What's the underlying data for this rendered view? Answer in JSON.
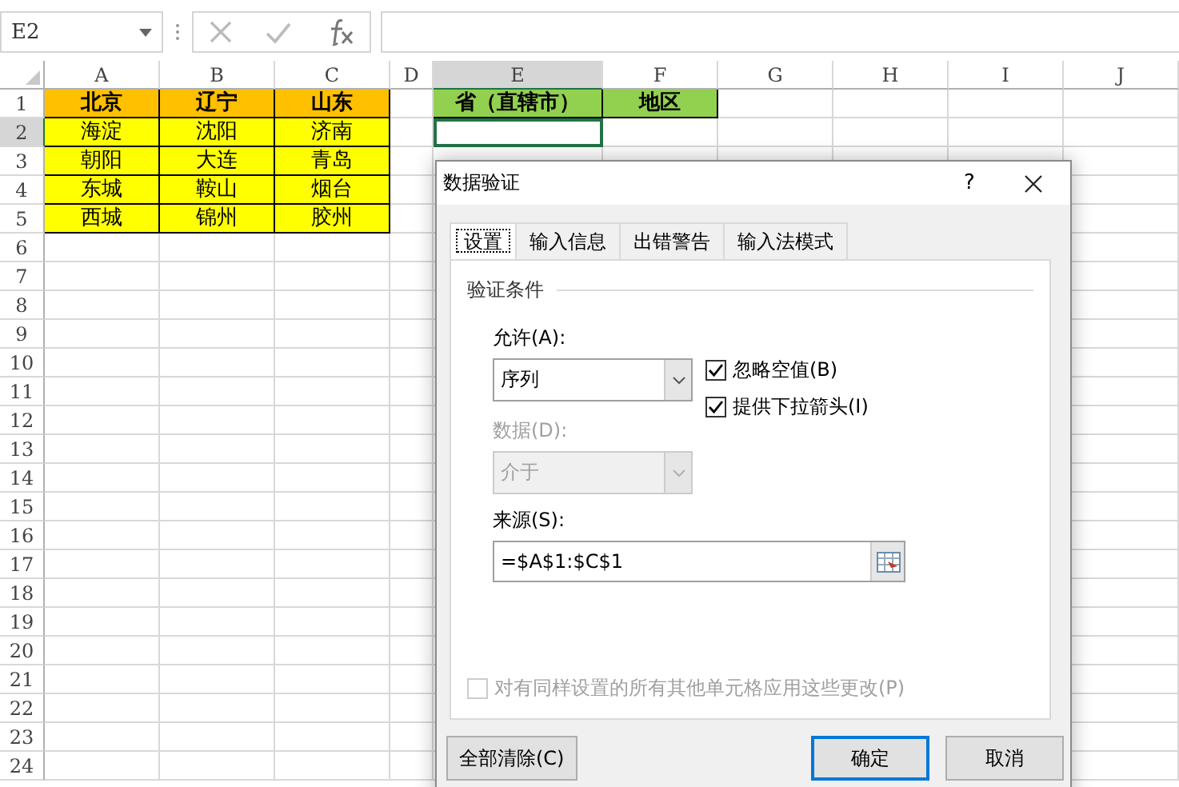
{
  "formula_bar": {
    "name_box": "E2"
  },
  "columns": [
    {
      "label": "A",
      "selected": false
    },
    {
      "label": "B",
      "selected": false
    },
    {
      "label": "C",
      "selected": false
    },
    {
      "label": "D",
      "selected": false
    },
    {
      "label": "E",
      "selected": true
    },
    {
      "label": "F",
      "selected": false
    },
    {
      "label": "G",
      "selected": false
    },
    {
      "label": "H",
      "selected": false
    },
    {
      "label": "I",
      "selected": false
    },
    {
      "label": "J",
      "selected": false
    }
  ],
  "rows": [
    {
      "label": "1",
      "selected": false
    },
    {
      "label": "2",
      "selected": true
    },
    {
      "label": "3",
      "selected": false
    },
    {
      "label": "4",
      "selected": false
    },
    {
      "label": "5",
      "selected": false
    },
    {
      "label": "6",
      "selected": false
    },
    {
      "label": "7",
      "selected": false
    },
    {
      "label": "8",
      "selected": false
    },
    {
      "label": "9",
      "selected": false
    },
    {
      "label": "10",
      "selected": false
    },
    {
      "label": "11",
      "selected": false
    },
    {
      "label": "12",
      "selected": false
    },
    {
      "label": "13",
      "selected": false
    },
    {
      "label": "14",
      "selected": false
    },
    {
      "label": "15",
      "selected": false
    },
    {
      "label": "16",
      "selected": false
    },
    {
      "label": "17",
      "selected": false
    },
    {
      "label": "18",
      "selected": false
    },
    {
      "label": "19",
      "selected": false
    },
    {
      "label": "20",
      "selected": false
    },
    {
      "label": "21",
      "selected": false
    },
    {
      "label": "22",
      "selected": false
    },
    {
      "label": "23",
      "selected": false
    },
    {
      "label": "24",
      "selected": false
    }
  ],
  "province_table": [
    {
      "cells": [
        {
          "text": "北京",
          "kind": "header",
          "color": "#ffc000"
        },
        {
          "text": "辽宁",
          "kind": "header",
          "color": "#ffc000"
        },
        {
          "text": "山东",
          "kind": "header",
          "color": "#ffc000"
        }
      ]
    },
    {
      "cells": [
        {
          "text": "海淀",
          "kind": "data",
          "color": "#ffff00"
        },
        {
          "text": "沈阳",
          "kind": "data",
          "color": "#ffff00"
        },
        {
          "text": "济南",
          "kind": "data",
          "color": "#ffff00"
        }
      ]
    },
    {
      "cells": [
        {
          "text": "朝阳",
          "kind": "data",
          "color": "#ffff00"
        },
        {
          "text": "大连",
          "kind": "data",
          "color": "#ffff00"
        },
        {
          "text": "青岛",
          "kind": "data",
          "color": "#ffff00"
        }
      ]
    },
    {
      "cells": [
        {
          "text": "东城",
          "kind": "data",
          "color": "#ffff00"
        },
        {
          "text": "鞍山",
          "kind": "data",
          "color": "#ffff00"
        },
        {
          "text": "烟台",
          "kind": "data",
          "color": "#ffff00"
        }
      ]
    },
    {
      "cells": [
        {
          "text": "西城",
          "kind": "data",
          "color": "#ffff00"
        },
        {
          "text": "锦州",
          "kind": "data",
          "color": "#ffff00"
        },
        {
          "text": "胶州",
          "kind": "data",
          "color": "#ffff00"
        }
      ]
    }
  ],
  "input_headers": [
    {
      "text": "省（直辖市）",
      "kind": "header",
      "color": "#92d050"
    },
    {
      "text": "地区",
      "kind": "header",
      "color": "#92d050"
    }
  ],
  "dialog": {
    "title": "数据验证",
    "help": "?",
    "tabs": [
      {
        "label": "设置",
        "selected": true
      },
      {
        "label": "输入信息",
        "selected": false
      },
      {
        "label": "出错警告",
        "selected": false
      },
      {
        "label": "输入法模式",
        "selected": false
      }
    ],
    "section": "验证条件",
    "allow": {
      "label": "允许(A):",
      "value": "序列",
      "disabled": false
    },
    "data": {
      "label": "数据(D):",
      "value": "介于",
      "disabled": true
    },
    "checkboxes": [
      {
        "label": "忽略空值(B)",
        "checked": true
      },
      {
        "label": "提供下拉箭头(I)",
        "checked": true
      }
    ],
    "source": {
      "label": "来源(S):",
      "value": "=$A$1:$C$1"
    },
    "apply_all": {
      "label": "对有同样设置的所有其他单元格应用这些更改(P)",
      "checked": false,
      "disabled": true
    },
    "buttons": [
      {
        "label": "全部清除(C)",
        "default": false
      },
      {
        "label": "确定",
        "default": true
      },
      {
        "label": "取消",
        "default": false
      }
    ]
  }
}
